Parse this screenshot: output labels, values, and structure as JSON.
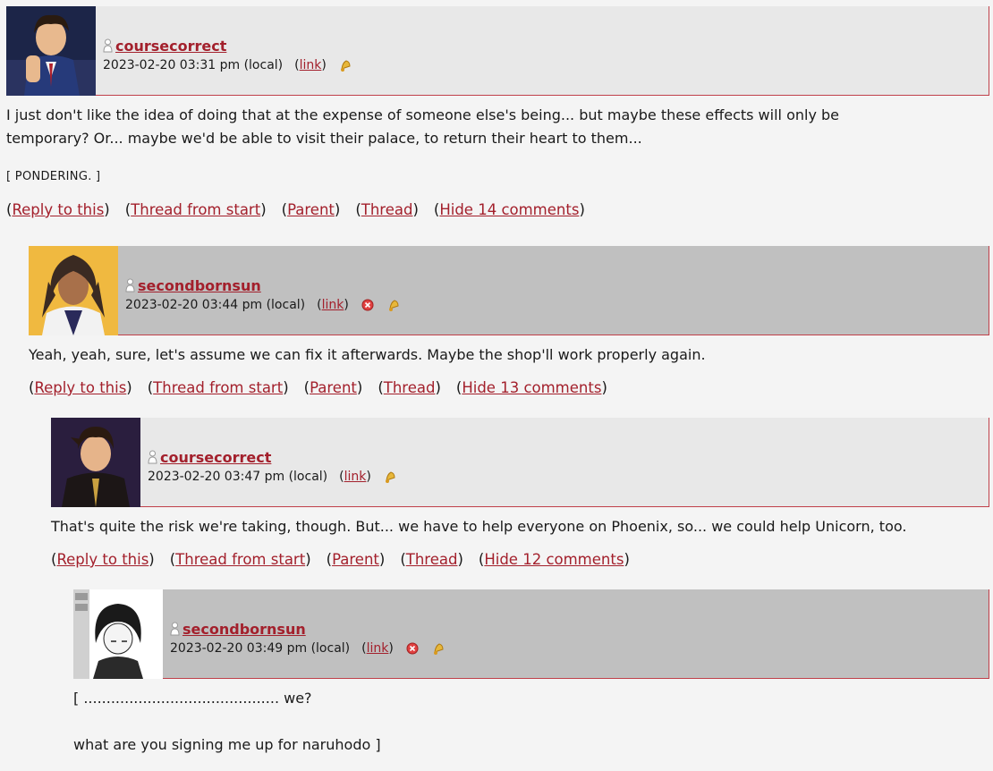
{
  "comments": [
    {
      "username": "coursecorrect",
      "date": "2023-02-20 03:31 pm (local)",
      "link_label": "link",
      "body": [
        "I just don't like the idea of doing that at the expense of someone else's being... but maybe these effects will only be",
        "temporary? Or... maybe we'd be able to visit their palace, to return their heart to them..."
      ],
      "action": "[ PONDERING. ]",
      "actions": [
        "Reply to this",
        "Thread from start",
        "Parent",
        "Thread",
        "Hide 14 comments"
      ]
    },
    {
      "username": "secondbornsun",
      "date": "2023-02-20 03:44 pm (local)",
      "link_label": "link",
      "body": [
        "Yeah, yeah, sure, let's assume we can fix it afterwards. Maybe the shop'll work properly again."
      ],
      "actions": [
        "Reply to this",
        "Thread from start",
        "Parent",
        "Thread",
        "Hide 13 comments"
      ]
    },
    {
      "username": "coursecorrect",
      "date": "2023-02-20 03:47 pm (local)",
      "link_label": "link",
      "body": [
        "That's quite the risk we're taking, though. But... we have to help everyone on Phoenix, so... we could help Unicorn, too."
      ],
      "actions": [
        "Reply to this",
        "Thread from start",
        "Parent",
        "Thread",
        "Hide 12 comments"
      ]
    },
    {
      "username": "secondbornsun",
      "date": "2023-02-20 03:49 pm (local)",
      "link_label": "link",
      "body": [
        "[ ........................................... we?",
        "",
        "what are you signing me up for naruhodo ]"
      ]
    }
  ],
  "colors": {
    "accent": "#a3202c",
    "header_light": "#e8e8e8",
    "header_dark": "#c0c0c0",
    "background": "#f4f4f4"
  },
  "icons": {
    "user": "user-icon",
    "delete": "delete-icon",
    "track": "bell-icon"
  }
}
